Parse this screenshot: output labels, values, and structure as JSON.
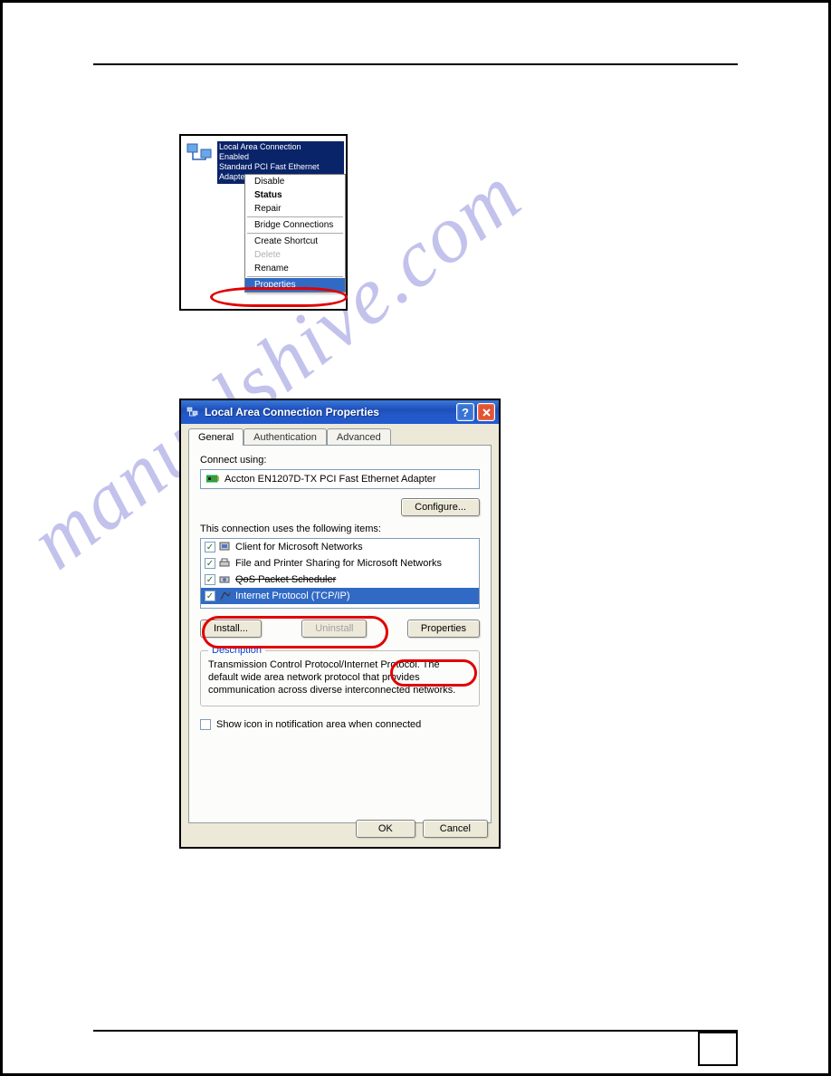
{
  "watermark": "manualshive.com",
  "fig1": {
    "conn_name": "Local Area Connection",
    "conn_status": "Enabled",
    "conn_adapter": "Standard PCI Fast Ethernet Adapter",
    "menu": {
      "disable": "Disable",
      "status": "Status",
      "repair": "Repair",
      "bridge": "Bridge Connections",
      "shortcut": "Create Shortcut",
      "delete": "Delete",
      "rename": "Rename",
      "properties": "Properties"
    }
  },
  "fig2": {
    "title": "Local Area Connection Properties",
    "tabs": {
      "general": "General",
      "auth": "Authentication",
      "adv": "Advanced"
    },
    "connect_using_label": "Connect using:",
    "adapter": "Accton EN1207D-TX PCI Fast Ethernet Adapter",
    "configure": "Configure...",
    "items_label": "This connection uses the following items:",
    "items": {
      "client": "Client for Microsoft Networks",
      "fps": "File and Printer Sharing for Microsoft Networks",
      "qos": "QoS Packet Scheduler",
      "tcpip": "Internet Protocol (TCP/IP)"
    },
    "install": "Install...",
    "uninstall": "Uninstall",
    "properties": "Properties",
    "desc_legend": "Description",
    "desc_text": "Transmission Control Protocol/Internet Protocol. The default wide area network protocol that provides communication across diverse interconnected networks.",
    "notif": "Show icon in notification area when connected",
    "ok": "OK",
    "cancel": "Cancel"
  }
}
